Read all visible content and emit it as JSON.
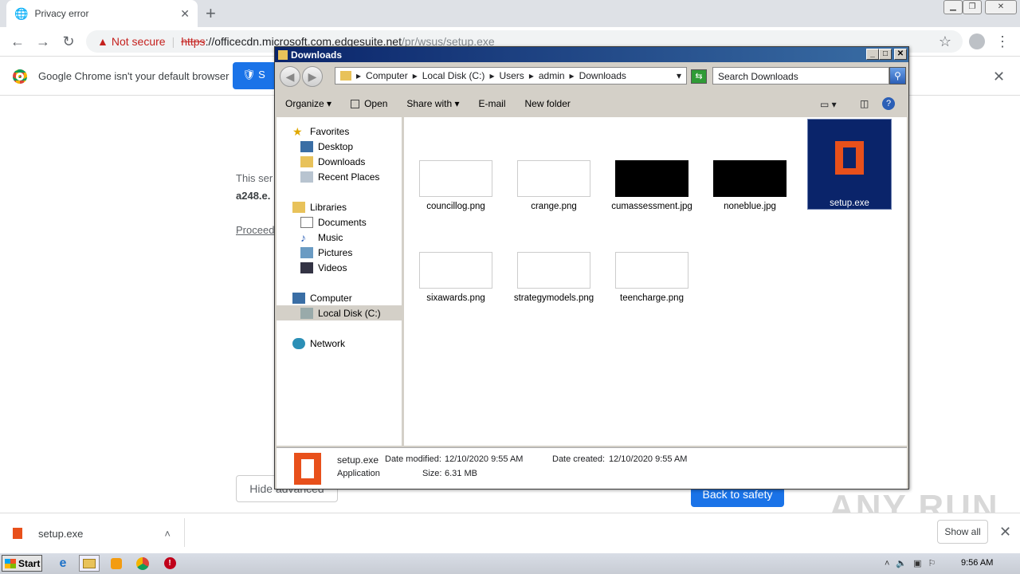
{
  "browser": {
    "tab_title": "Privacy error",
    "url_scheme": "https",
    "url_host": "://officecdn.microsoft.com.edgesuite.net",
    "url_path": "/pr/wsus/setup.exe",
    "not_secure": "Not secure",
    "infobar_message": "Google Chrome isn't your default browser",
    "infobar_button": "S"
  },
  "page": {
    "text1": "This ser",
    "text2": "a248.e.",
    "proceed": "Proceed",
    "hide_advanced": "Hide advanced",
    "back_to_safety": "Back to safety"
  },
  "download_bar": {
    "file": "setup.exe",
    "show_all": "Show all"
  },
  "explorer": {
    "title": "Downloads",
    "breadcrumb": [
      "Computer",
      "Local Disk (C:)",
      "Users",
      "admin",
      "Downloads"
    ],
    "search_placeholder": "Search Downloads",
    "commands": [
      "Organize",
      "Open",
      "Share with",
      "E-mail",
      "New folder"
    ],
    "nav": {
      "favorites": "Favorites",
      "desktop": "Desktop",
      "downloads": "Downloads",
      "recent": "Recent Places",
      "libraries": "Libraries",
      "documents": "Documents",
      "music": "Music",
      "pictures": "Pictures",
      "videos": "Videos",
      "computer": "Computer",
      "local_disk": "Local Disk (C:)",
      "network": "Network"
    },
    "files": [
      {
        "name": "councillog.png"
      },
      {
        "name": "crange.png"
      },
      {
        "name": "cumassessment.jpg"
      },
      {
        "name": "noneblue.jpg"
      },
      {
        "name": "setup.exe"
      },
      {
        "name": "sixawards.png"
      },
      {
        "name": "strategymodels.png"
      },
      {
        "name": "teencharge.png"
      }
    ],
    "details": {
      "name": "setup.exe",
      "modified_label": "Date modified:",
      "modified": "12/10/2020 9:55 AM",
      "created_label": "Date created:",
      "created": "12/10/2020 9:55 AM",
      "type": "Application",
      "size_label": "Size:",
      "size": "6.31 MB"
    }
  },
  "taskbar": {
    "start": "Start",
    "clock": "9:56 AM"
  },
  "watermark": "ANY RUN",
  "colors": {
    "office": "#e8501b",
    "chrome_blue": "#1a73e8",
    "selection": "#0a246a"
  }
}
